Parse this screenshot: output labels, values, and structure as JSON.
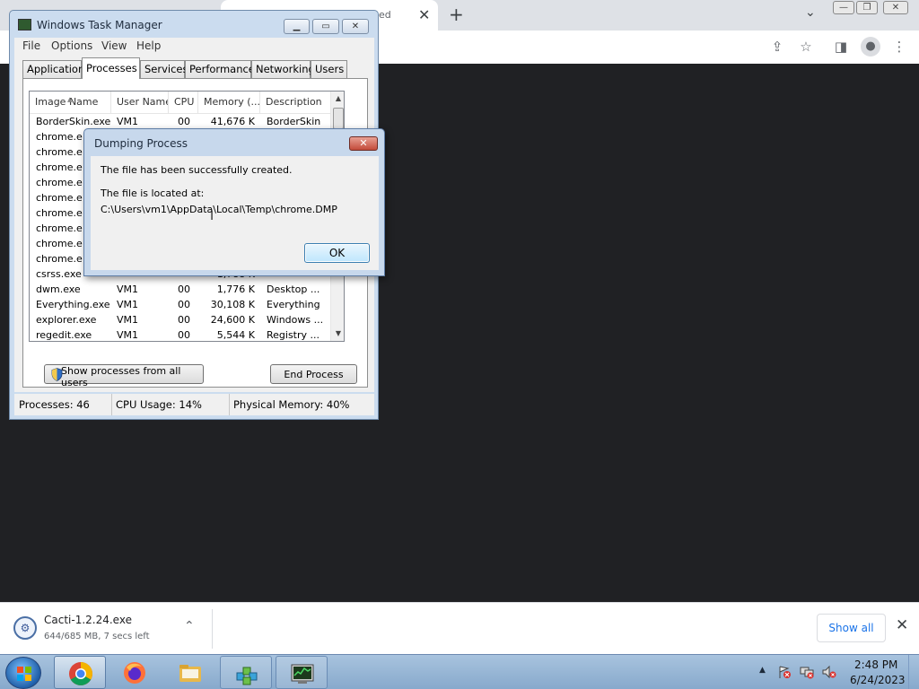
{
  "browser": {
    "tab_title_fragment": "ed",
    "download": {
      "file_name": "Cacti-1.2.24.exe",
      "status": "644/685 MB, 7 secs left",
      "show_all_label": "Show all"
    },
    "icons": [
      "new-tab-icon",
      "tab-search-icon",
      "share-icon",
      "bookmark-star-icon",
      "side-panel-icon",
      "profile-icon",
      "menu-icon"
    ]
  },
  "task_manager": {
    "title": "Windows Task Manager",
    "menu": [
      "File",
      "Options",
      "View",
      "Help"
    ],
    "tabs": [
      "Applications",
      "Processes",
      "Services",
      "Performance",
      "Networking",
      "Users"
    ],
    "active_tab": "Processes",
    "columns": [
      "Image Name",
      "User Name",
      "CPU",
      "Memory (...",
      "Description"
    ],
    "rows": [
      {
        "image": "BorderSkin.exe",
        "user": "VM1",
        "cpu": "00",
        "memory": "41,676 K",
        "description": "BorderSkin"
      },
      {
        "image": "chrome.e",
        "user": "",
        "cpu": "",
        "memory": "",
        "description": ""
      },
      {
        "image": "chrome.e",
        "user": "",
        "cpu": "",
        "memory": "",
        "description": ""
      },
      {
        "image": "chrome.e",
        "user": "",
        "cpu": "",
        "memory": "",
        "description": ""
      },
      {
        "image": "chrome.e",
        "user": "",
        "cpu": "",
        "memory": "",
        "description": ""
      },
      {
        "image": "chrome.e",
        "user": "",
        "cpu": "",
        "memory": "",
        "description": ""
      },
      {
        "image": "chrome.e",
        "user": "",
        "cpu": "",
        "memory": "",
        "description": ""
      },
      {
        "image": "chrome.e",
        "user": "",
        "cpu": "",
        "memory": "",
        "description": ""
      },
      {
        "image": "chrome.e",
        "user": "",
        "cpu": "",
        "memory": "",
        "description": ""
      },
      {
        "image": "chrome.e",
        "user": "",
        "cpu": "",
        "memory": "",
        "description": ""
      },
      {
        "image": "csrss.exe",
        "user": "",
        "cpu": "",
        "memory": "1,788 K",
        "description": ""
      },
      {
        "image": "dwm.exe",
        "user": "VM1",
        "cpu": "00",
        "memory": "1,776 K",
        "description": "Desktop ..."
      },
      {
        "image": "Everything.exe",
        "user": "VM1",
        "cpu": "00",
        "memory": "30,108 K",
        "description": "Everything"
      },
      {
        "image": "explorer.exe",
        "user": "VM1",
        "cpu": "00",
        "memory": "24,600 K",
        "description": "Windows ..."
      },
      {
        "image": "regedit.exe",
        "user": "VM1",
        "cpu": "00",
        "memory": "5,544 K",
        "description": "Registry ..."
      }
    ],
    "show_all_button": "Show processes from all users",
    "end_process_button": "End Process",
    "status": {
      "processes": "Processes: 46",
      "cpu": "CPU Usage: 14%",
      "memory": "Physical Memory: 40%"
    }
  },
  "dialog": {
    "title": "Dumping Process",
    "message": "The file has been successfully created.",
    "location_label": "The file is located at:",
    "path": "C:\\Users\\vm1\\AppData\\Local\\Temp\\chrome.DMP",
    "ok_label": "OK"
  },
  "taskbar": {
    "apps": [
      "chrome",
      "firefox",
      "file-explorer",
      "registry-editor",
      "task-manager"
    ],
    "active_app": "chrome",
    "clock_time": "2:48 PM",
    "clock_date": "6/24/2023"
  },
  "colors": {
    "desktop_bg": "#202124",
    "window_frame": "#cbdcef",
    "link_blue": "#1a73e8",
    "dialog_close_red": "#c34b3a"
  }
}
